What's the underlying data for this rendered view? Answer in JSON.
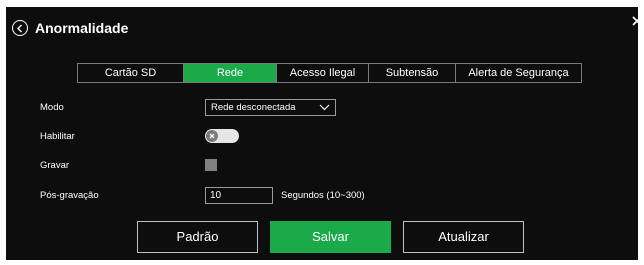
{
  "dialog": {
    "title": "Anormalidade"
  },
  "tabs": [
    {
      "label": "Cartão SD",
      "active": false
    },
    {
      "label": "Rede",
      "active": true
    },
    {
      "label": "Acesso Ilegal",
      "active": false
    },
    {
      "label": "Subtensão",
      "active": false
    },
    {
      "label": "Alerta de Segurança",
      "active": false
    }
  ],
  "form": {
    "modo": {
      "label": "Modo",
      "value": "Rede desconectada"
    },
    "habilitar": {
      "label": "Habilitar",
      "enabled": false
    },
    "gravar": {
      "label": "Gravar",
      "checked": false
    },
    "pos_gravacao": {
      "label": "Pós-gravação",
      "value": "10",
      "hint": "Segundos (10~300)"
    }
  },
  "buttons": {
    "default_label": "Padrão",
    "save_label": "Salvar",
    "refresh_label": "Atualizar"
  },
  "colors": {
    "accent": "#1aaa4a",
    "background": "#0d0d0d",
    "text": "#ffffff"
  },
  "icons": {
    "back": "chevron-left-circle-icon",
    "close": "close-icon",
    "dropdown": "chevron-down-icon",
    "toggle_off": "x-circle-icon"
  }
}
